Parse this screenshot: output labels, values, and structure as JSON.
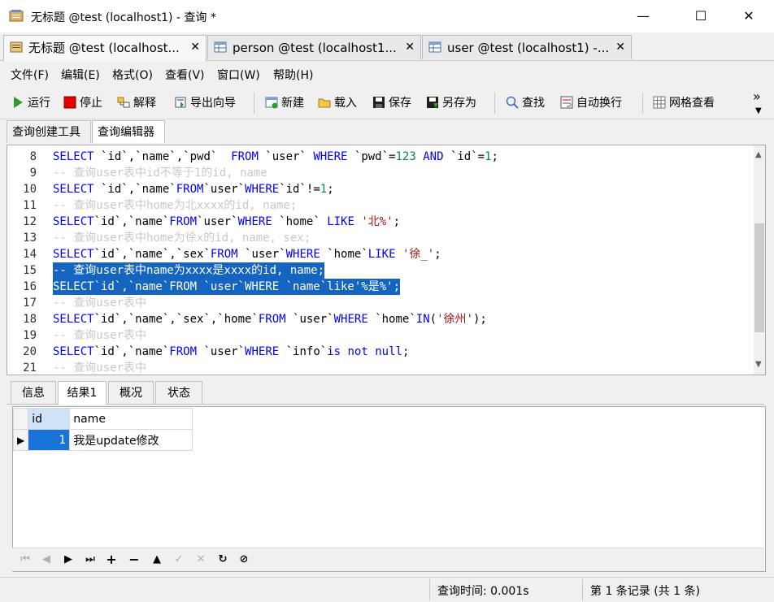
{
  "window": {
    "title": "无标题 @test (localhost1) - 查询 *",
    "controls": {
      "minimize": "—",
      "maximize": "☐",
      "close": "✕"
    }
  },
  "doc_tabs": [
    {
      "label": "无标题 @test (localhost...",
      "close": "✕",
      "active": true
    },
    {
      "label": "person @test (localhost1...",
      "close": "✕",
      "active": false
    },
    {
      "label": "user @test (localhost1) -...",
      "close": "✕",
      "active": false
    }
  ],
  "menu": [
    "文件(F)",
    "编辑(E)",
    "格式(O)",
    "查看(V)",
    "窗口(W)",
    "帮助(H)"
  ],
  "toolbar": {
    "run": "运行",
    "stop": "停止",
    "explain": "解释",
    "export_wizard": "导出向导",
    "new": "新建",
    "load": "载入",
    "save": "保存",
    "save_as": "另存为",
    "find": "查找",
    "word_wrap": "自动换行",
    "grid_view": "网格查看",
    "overflow": "»"
  },
  "sub_tabs": [
    "查询创建工具",
    "查询编辑器"
  ],
  "editor": {
    "lines": [
      {
        "n": "8",
        "type": "sql",
        "text": "SELECT `id`,`name`,`pwd`  FROM `user` WHERE `pwd`=123 AND `id`=1;"
      },
      {
        "n": "9",
        "type": "comment",
        "text": "-- 查询user表中id不等于1的id, name"
      },
      {
        "n": "10",
        "type": "sql",
        "text": "SELECT `id`,`name`FROM`user`WHERE`id`!=1;"
      },
      {
        "n": "11",
        "type": "comment",
        "text": "-- 查询user表中home为北xxxx的id, name;"
      },
      {
        "n": "12",
        "type": "sql",
        "text": "SELECT`id`,`name`FROM`user`WHERE `home` LIKE '北%';"
      },
      {
        "n": "13",
        "type": "comment",
        "text": "-- 查询user表中home为徐x的id, name, sex;"
      },
      {
        "n": "14",
        "type": "sql",
        "text": "SELECT`id`,`name`,`sex`FROM `user`WHERE `home`LIKE '徐_';"
      },
      {
        "n": "15",
        "type": "comment",
        "text": "-- 查询user表中name为xxxx是xxxx的id, name;",
        "selected": true
      },
      {
        "n": "16",
        "type": "sql",
        "text": "SELECT`id`,`name`FROM `user`WHERE `name`like'%是%';",
        "selected": true
      },
      {
        "n": "17",
        "type": "comment",
        "text": "-- 查询user表中"
      },
      {
        "n": "18",
        "type": "sql",
        "text": "SELECT`id`,`name`,`sex`,`home`FROM `user`WHERE `home`IN('徐州');"
      },
      {
        "n": "19",
        "type": "comment",
        "text": "-- 查询user表中"
      },
      {
        "n": "20",
        "type": "sql",
        "text": "SELECT`id`,`name`FROM `user`WHERE `info`is not null;"
      },
      {
        "n": "21",
        "type": "comment",
        "text": "-- 查询user表中"
      }
    ]
  },
  "result_tabs": [
    "信息",
    "结果1",
    "概况",
    "状态"
  ],
  "result_grid": {
    "columns": [
      "id",
      "name"
    ],
    "rows": [
      [
        "1",
        "我是update修改"
      ]
    ]
  },
  "status": {
    "query_time": "查询时间: 0.001s",
    "records": "第 1 条记录 (共 1 条)"
  },
  "colors": {
    "selection": "#1565c0",
    "keyword": "#0000ff",
    "comment": "#c8c8c8",
    "string": "#a31515",
    "run_icon": "#2e9d2e",
    "stop_icon": "#e00000"
  }
}
